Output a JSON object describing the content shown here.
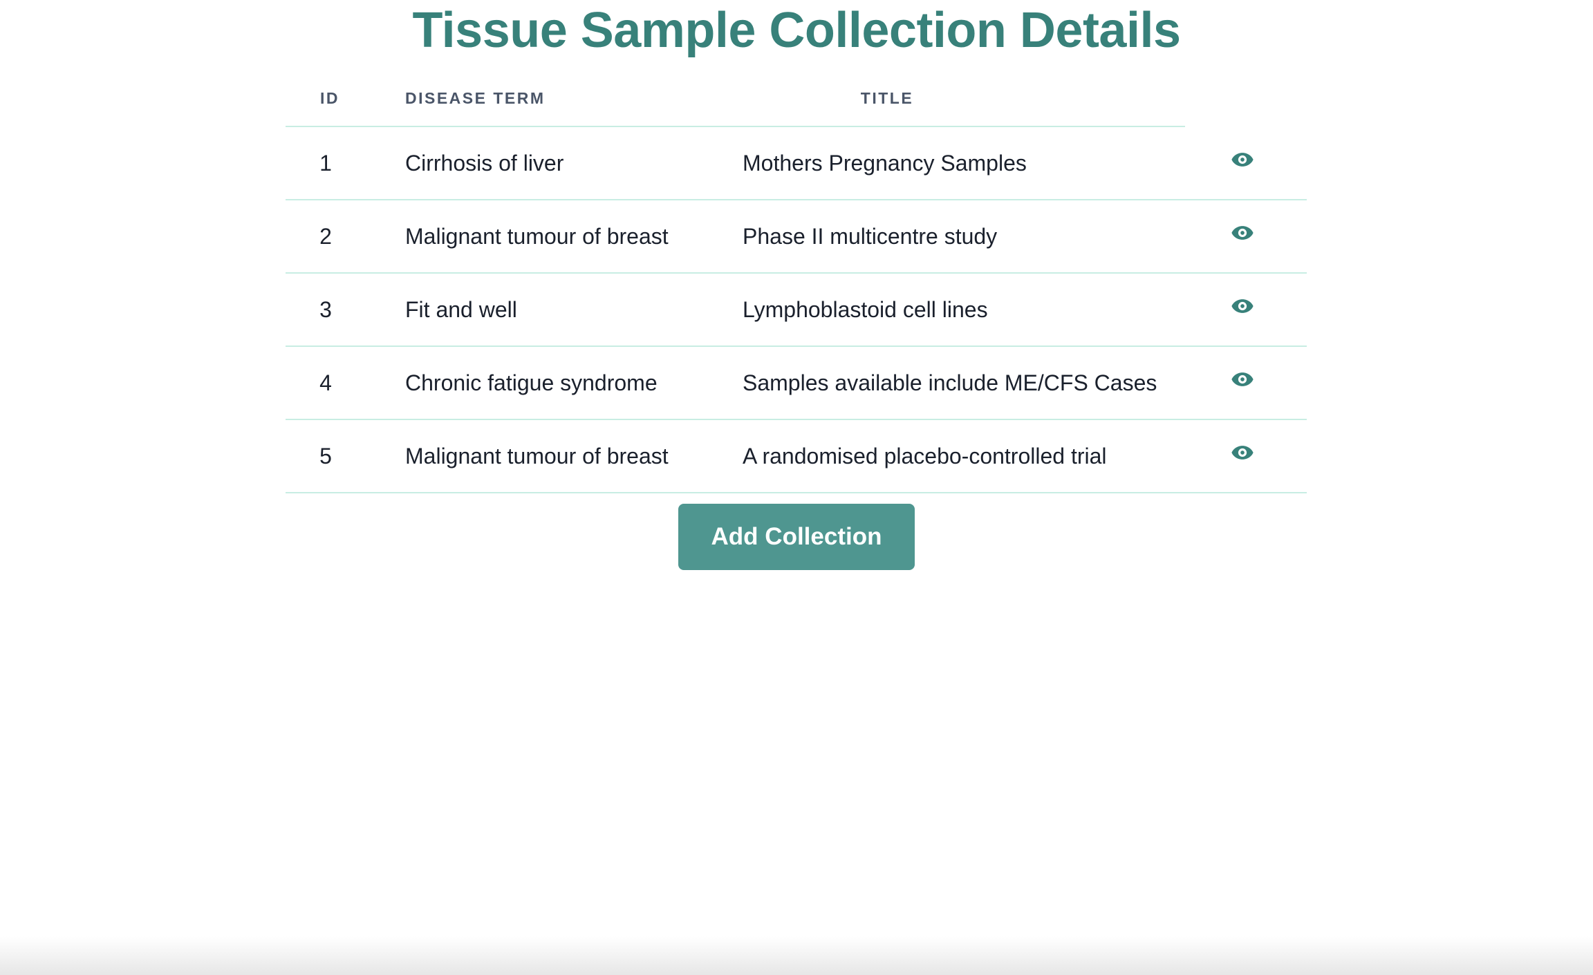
{
  "page": {
    "title": "Tissue Sample Collection Details"
  },
  "table": {
    "headers": {
      "id": "ID",
      "disease_term": "DISEASE TERM",
      "title": "TITLE"
    },
    "rows": [
      {
        "id": "1",
        "disease_term": "Cirrhosis of liver",
        "title": "Mothers Pregnancy Samples",
        "action_icon": "eye-icon"
      },
      {
        "id": "2",
        "disease_term": "Malignant tumour of breast",
        "title": "Phase II multicentre study",
        "action_icon": "eye-icon"
      },
      {
        "id": "3",
        "disease_term": "Fit and well",
        "title": "Lymphoblastoid cell lines",
        "action_icon": "eye-icon"
      },
      {
        "id": "4",
        "disease_term": "Chronic fatigue syndrome",
        "title": "Samples available include ME/CFS Cases",
        "action_icon": "eye-icon"
      },
      {
        "id": "5",
        "disease_term": "Malignant tumour of breast",
        "title": "A randomised placebo-controlled trial",
        "action_icon": "eye-icon"
      }
    ]
  },
  "actions": {
    "add_collection_label": "Add Collection"
  },
  "colors": {
    "accent": "#38817a",
    "button_bg": "#4f9690",
    "divider": "#c8ede3",
    "header_text": "#4a5568",
    "body_text": "#1a202c"
  }
}
